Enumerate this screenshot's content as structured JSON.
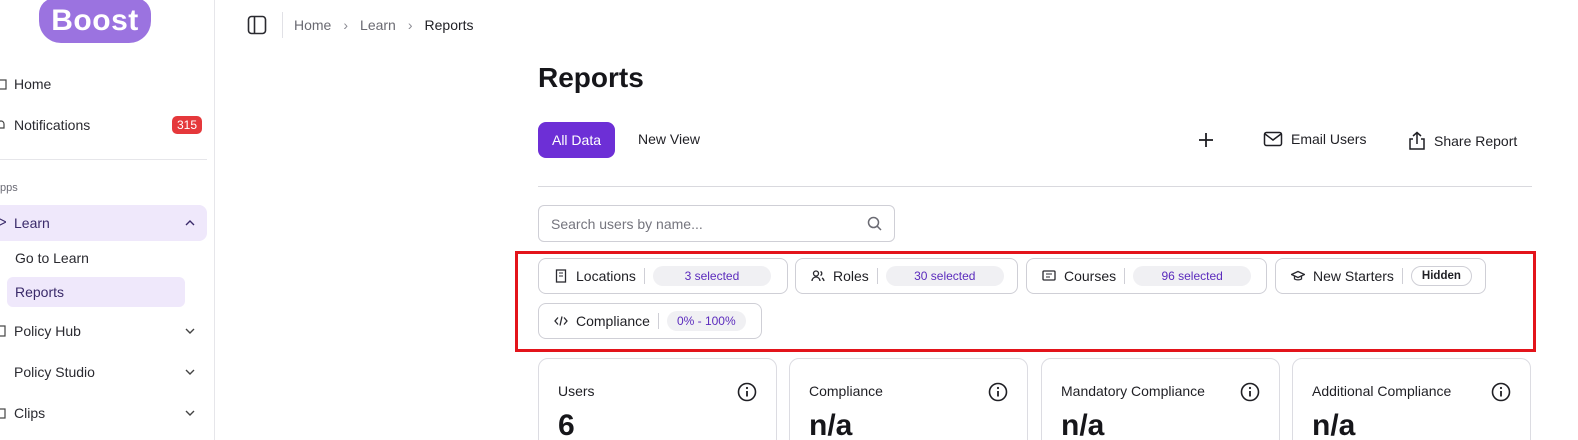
{
  "brand": {
    "logo_text": "Boost",
    "accent": "#6d2fd6",
    "logo_bg": "#9b73e0"
  },
  "sidebar": {
    "home_label": "Home",
    "notifications_label": "Notifications",
    "notifications_count": "315",
    "section_apps": "pps",
    "learn_label": "Learn",
    "learn_children": [
      "Go to Learn",
      "Reports"
    ],
    "policy_hub_label": "Policy Hub",
    "policy_studio_label": "Policy Studio",
    "clips_label": "Clips"
  },
  "breadcrumb": [
    "Home",
    "Learn",
    "Reports"
  ],
  "page": {
    "title": "Reports",
    "tabs": [
      "All Data",
      "New View"
    ],
    "actions": {
      "add": "add-icon",
      "email": "Email Users",
      "share": "Share Report"
    },
    "search_placeholder": "Search users by name..."
  },
  "filters": [
    {
      "label": "Locations",
      "value": "3 selected",
      "icon": "building-icon"
    },
    {
      "label": "Roles",
      "value": "30 selected",
      "icon": "users-icon"
    },
    {
      "label": "Courses",
      "value": "96 selected",
      "icon": "course-icon"
    },
    {
      "label": "New Starters",
      "value": "Hidden",
      "icon": "graduation-cap-icon"
    },
    {
      "label": "Compliance",
      "value": "0% - 100%",
      "icon": "code-icon"
    }
  ],
  "cards": [
    {
      "label": "Users",
      "value": "6"
    },
    {
      "label": "Compliance",
      "value": "n/a"
    },
    {
      "label": "Mandatory Compliance",
      "value": "n/a"
    },
    {
      "label": "Additional Compliance",
      "value": "n/a"
    }
  ]
}
